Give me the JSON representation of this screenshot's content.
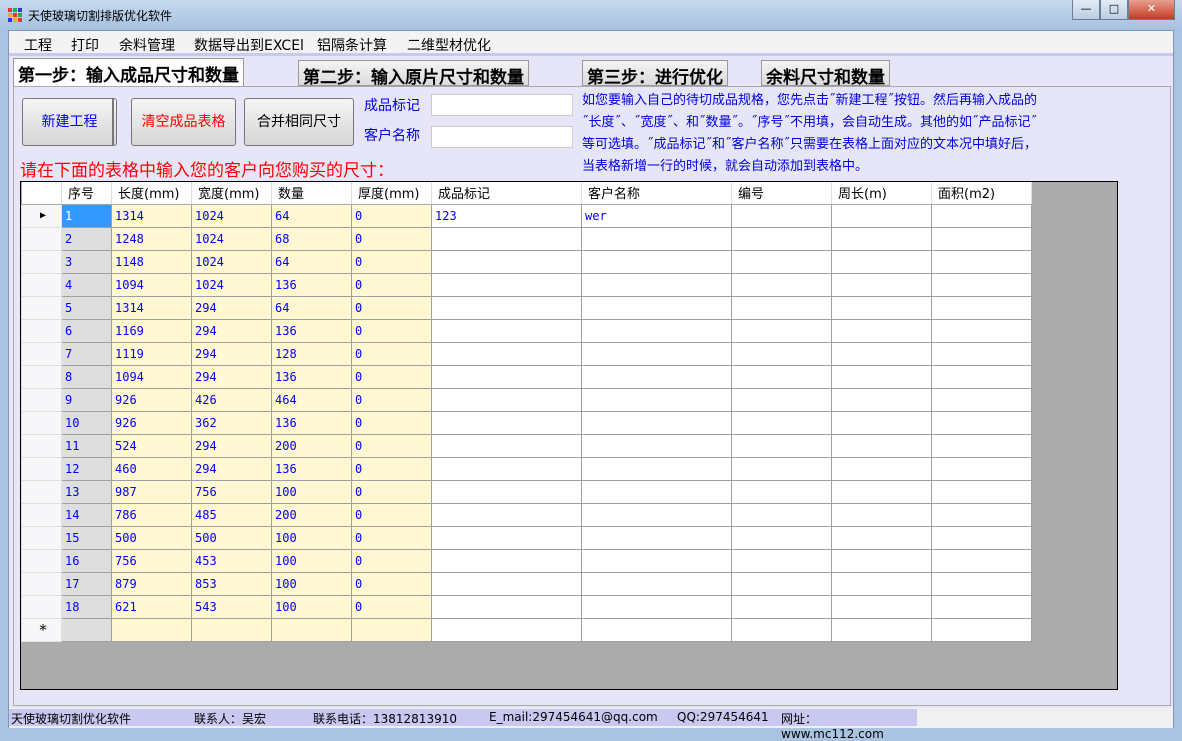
{
  "window": {
    "title": "天使玻璃切割排版优化软件",
    "minimize": "—",
    "maximize": "□",
    "close": "✕"
  },
  "menu": [
    "工程",
    "打印",
    "余料管理",
    "数据导出到EXCEl",
    "铝隔条计算",
    "二维型材优化"
  ],
  "tabs": [
    "第一步：输入成品尺寸和数量",
    "第二步：输入原片尺寸和数量",
    "第三步：进行优化",
    "余料尺寸和数量"
  ],
  "buttons": {
    "new": "新建工程",
    "clear": "清空成品表格",
    "merge": "合并相同尺寸"
  },
  "fields": {
    "mark_label": "成品标记",
    "mark_value": "",
    "customer_label": "客户名称",
    "customer_value": ""
  },
  "help": [
    "如您要输入自己的待切成品规格，您先点击˝新建工程˝按钮。然后再输入成品的",
    "˝长度˝、˝宽度˝、和˝数量˝。˝序号˝不用填，会自动生成。其他的如˝产品标记˝",
    "等可选填。˝成品标记˝和˝客户名称˝只需要在表格上面对应的文本况中填好后，",
    "当表格新增一行的时候，就会自动添加到表格中。"
  ],
  "prompt": "请在下面的表格中输入您的客户向您购买的尺寸：",
  "grid": {
    "columns": [
      "序号",
      "长度(mm)",
      "宽度(mm)",
      "数量",
      "厚度(mm)",
      "成品标记",
      "客户名称",
      "编号",
      "周长(m)",
      "面积(m2)"
    ],
    "current_row_marker": "▶",
    "new_row_marker": "*",
    "rows": [
      [
        "1",
        "1314",
        "1024",
        "64",
        "0",
        "123",
        "wer",
        "",
        "",
        ""
      ],
      [
        "2",
        "1248",
        "1024",
        "68",
        "0",
        "",
        "",
        "",
        "",
        ""
      ],
      [
        "3",
        "1148",
        "1024",
        "64",
        "0",
        "",
        "",
        "",
        "",
        ""
      ],
      [
        "4",
        "1094",
        "1024",
        "136",
        "0",
        "",
        "",
        "",
        "",
        ""
      ],
      [
        "5",
        "1314",
        "294",
        "64",
        "0",
        "",
        "",
        "",
        "",
        ""
      ],
      [
        "6",
        "1169",
        "294",
        "136",
        "0",
        "",
        "",
        "",
        "",
        ""
      ],
      [
        "7",
        "1119",
        "294",
        "128",
        "0",
        "",
        "",
        "",
        "",
        ""
      ],
      [
        "8",
        "1094",
        "294",
        "136",
        "0",
        "",
        "",
        "",
        "",
        ""
      ],
      [
        "9",
        "926",
        "426",
        "464",
        "0",
        "",
        "",
        "",
        "",
        ""
      ],
      [
        "10",
        "926",
        "362",
        "136",
        "0",
        "",
        "",
        "",
        "",
        ""
      ],
      [
        "11",
        "524",
        "294",
        "200",
        "0",
        "",
        "",
        "",
        "",
        ""
      ],
      [
        "12",
        "460",
        "294",
        "136",
        "0",
        "",
        "",
        "",
        "",
        ""
      ],
      [
        "13",
        "987",
        "756",
        "100",
        "0",
        "",
        "",
        "",
        "",
        ""
      ],
      [
        "14",
        "786",
        "485",
        "200",
        "0",
        "",
        "",
        "",
        "",
        ""
      ],
      [
        "15",
        "500",
        "500",
        "100",
        "0",
        "",
        "",
        "",
        "",
        ""
      ],
      [
        "16",
        "756",
        "453",
        "100",
        "0",
        "",
        "",
        "",
        "",
        ""
      ],
      [
        "17",
        "879",
        "853",
        "100",
        "0",
        "",
        "",
        "",
        "",
        ""
      ],
      [
        "18",
        "621",
        "543",
        "100",
        "0",
        "",
        "",
        "",
        "",
        ""
      ]
    ]
  },
  "status": [
    "天使玻璃切割优化软件",
    "联系人：吴宏",
    "联系电话：13812813910",
    "E_mail:297454641@qq.com",
    "QQ:297454641",
    "网址：www.mc112.com"
  ]
}
